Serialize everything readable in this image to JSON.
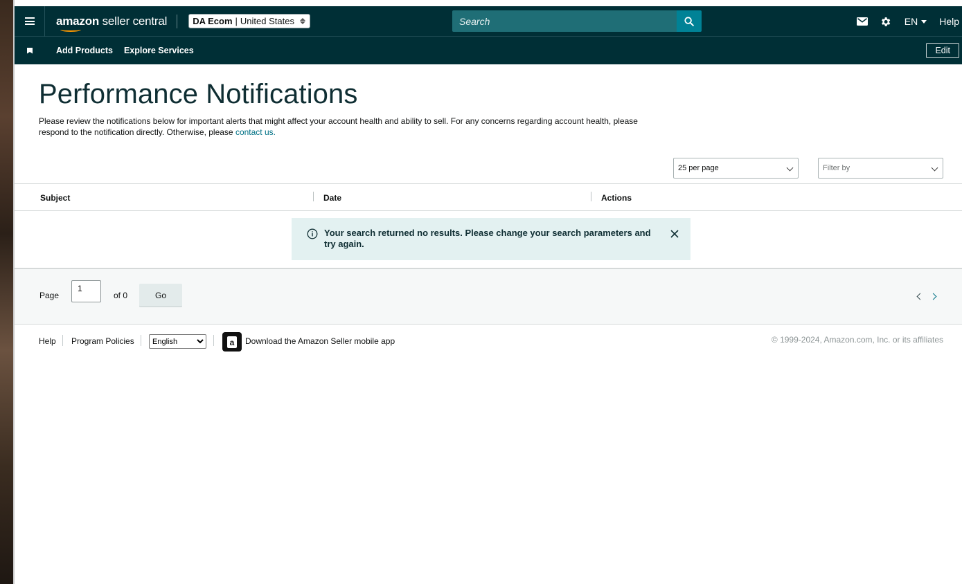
{
  "header": {
    "logo_bold": "amazon",
    "logo_rest": " seller central",
    "account": "DA Ecom",
    "marketplace": "United States",
    "search_placeholder": "Search",
    "language": "EN",
    "help": "Help",
    "icons": [
      "menu-icon",
      "search-icon",
      "mail-icon",
      "gear-icon"
    ]
  },
  "subnav": {
    "items": [
      "Add Products",
      "Explore Services"
    ],
    "edit": "Edit"
  },
  "page": {
    "title": "Performance Notifications",
    "description": "Please review the notifications below for important alerts that might affect your account health and ability to sell. For any concerns regarding account health, please respond to the notification directly. Otherwise, please ",
    "contact_link": "contact us.",
    "per_page": "25 per page",
    "filter_placeholder": "Filter by"
  },
  "table": {
    "columns": [
      "Subject",
      "Date",
      "Actions"
    ],
    "empty_message": "Your search returned no results. Please change your search parameters and try again."
  },
  "pager": {
    "page_label": "Page",
    "current_page": "1",
    "of_label": "of 0",
    "go": "Go"
  },
  "footer": {
    "help": "Help",
    "policies": "Program Policies",
    "language_selected": "English",
    "app_link": "Download the Amazon Seller mobile app",
    "copyright": "© 1999-2024, Amazon.com, Inc. or its affiliates"
  },
  "colors": {
    "header_bg": "#002f36",
    "search_btn": "#008296",
    "link": "#007185",
    "alert_bg": "#e3f1f1"
  }
}
